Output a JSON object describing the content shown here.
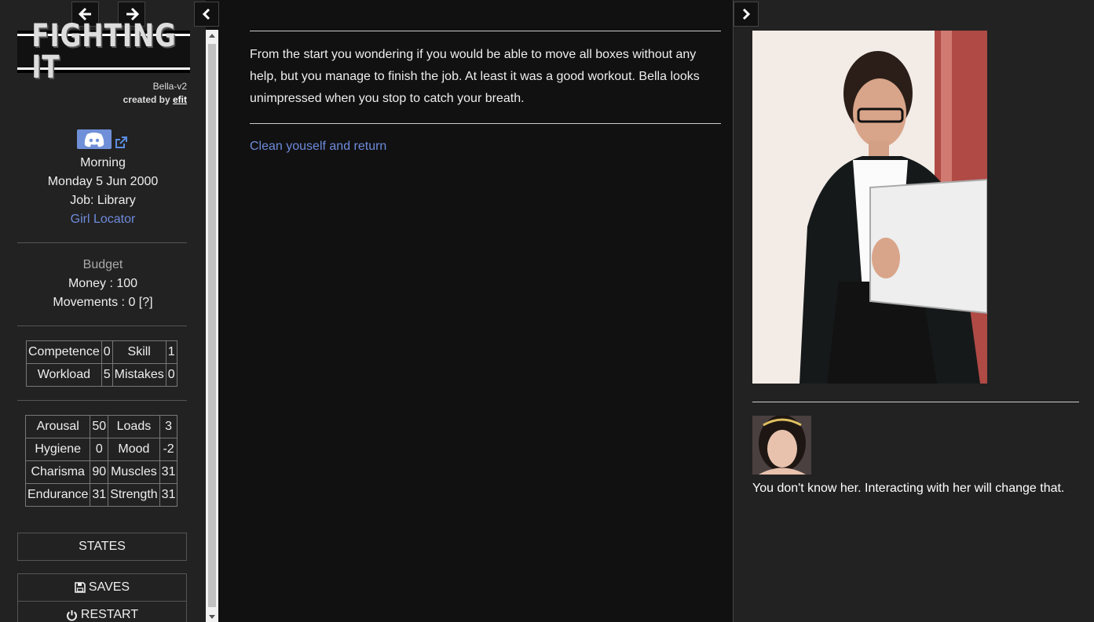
{
  "sidebar": {
    "back_icon": "arrow-left-icon",
    "forward_icon": "arrow-right-icon",
    "logo_text": "FIGHTING IT",
    "version": "Bella-v2",
    "credit_prefix": "created by",
    "credit_author": "efit",
    "time_of_day": "Morning",
    "date": "Monday 5 Jun 2000",
    "job": "Job: Library",
    "girl_locator": "Girl Locator",
    "budget_title": "Budget",
    "money": "Money : 100",
    "movements": "Movements : 0 [?]",
    "work_stats": [
      [
        "Competence",
        "0",
        "Skill",
        "1"
      ],
      [
        "Workload",
        "5",
        "Mistakes",
        "0"
      ]
    ],
    "char_stats": [
      [
        "Arousal",
        "50",
        "Loads",
        "3"
      ],
      [
        "Hygiene",
        "0",
        "Mood",
        "-2"
      ],
      [
        "Charisma",
        "90",
        "Muscles",
        "31"
      ],
      [
        "Endurance",
        "31",
        "Strength",
        "31"
      ]
    ],
    "states_label": "STATES",
    "saves_label": "SAVES",
    "restart_label": "RESTART"
  },
  "main": {
    "passage": "From the start you wondering if you would be able to move all boxes without any help, but you manage to finish the job. At least it was a good workout. Bella looks unimpressed when you stop to catch your breath.",
    "link_return": "Clean youself and return"
  },
  "right": {
    "unknown_text": "You don't know her. Interacting with her will change that."
  },
  "colors": {
    "link": "#6e8bdc",
    "sidebar_bg": "#222222",
    "main_bg": "#111111",
    "discord": "#6f8fd8"
  }
}
